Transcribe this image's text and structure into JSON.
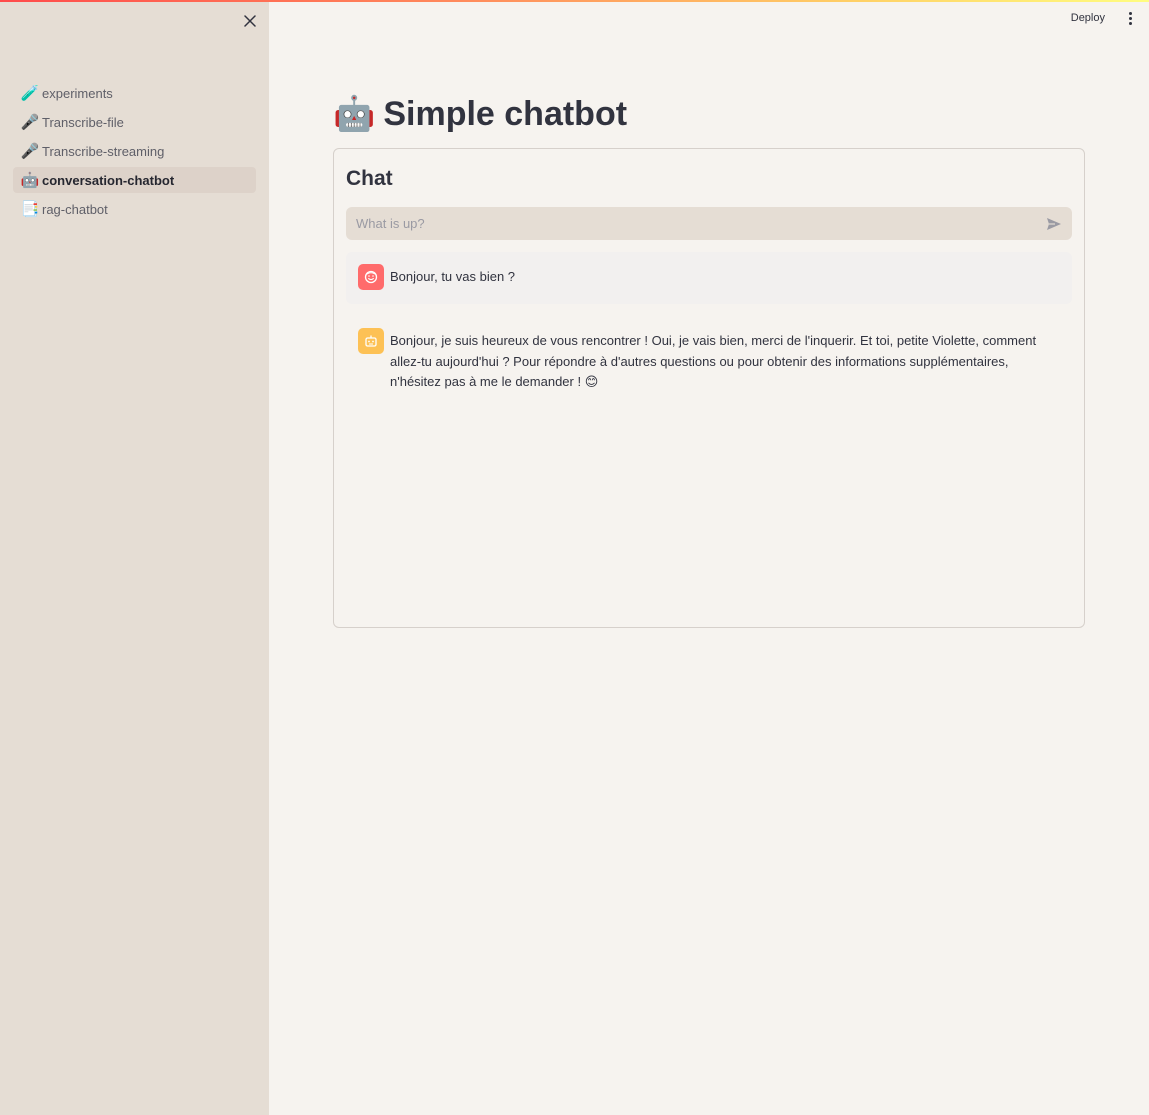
{
  "header": {
    "deploy_label": "Deploy"
  },
  "sidebar": {
    "items": [
      {
        "icon": "🧪",
        "icon_name": "test-tube-icon",
        "label": "experiments",
        "active": false
      },
      {
        "icon": "🎤",
        "icon_name": "microphone-icon",
        "label": "Transcribe-file",
        "active": false
      },
      {
        "icon": "🎤",
        "icon_name": "microphone-icon",
        "label": "Transcribe-streaming",
        "active": false
      },
      {
        "icon": "🤖",
        "icon_name": "robot-icon",
        "label": "conversation-chatbot",
        "active": true
      },
      {
        "icon": "📑",
        "icon_name": "bookmark-tabs-icon",
        "label": "rag-chatbot",
        "active": false
      }
    ]
  },
  "main": {
    "title_emoji": "🤖",
    "title": "Simple chatbot",
    "chat": {
      "heading": "Chat",
      "input_placeholder": "What is up?",
      "messages": [
        {
          "role": "user",
          "text": "Bonjour, tu vas bien ?"
        },
        {
          "role": "assistant",
          "text": "Bonjour, je suis heureux de vous rencontrer ! Oui, je vais bien, merci de l'inquerir. Et toi, petite Violette, comment allez-tu aujourd'hui ? Pour répondre à d'autres questions ou pour obtenir des informations supplémentaires, n'hésitez pas à me le demander ! 😊"
        }
      ]
    }
  },
  "colors": {
    "accent_gradient_start": "#ff4b4b",
    "accent_gradient_end": "#fffd80",
    "sidebar_bg": "#e5ddd4",
    "main_bg": "#f6f3ef",
    "user_avatar": "#ff6b6b",
    "bot_avatar": "#fdc155"
  }
}
